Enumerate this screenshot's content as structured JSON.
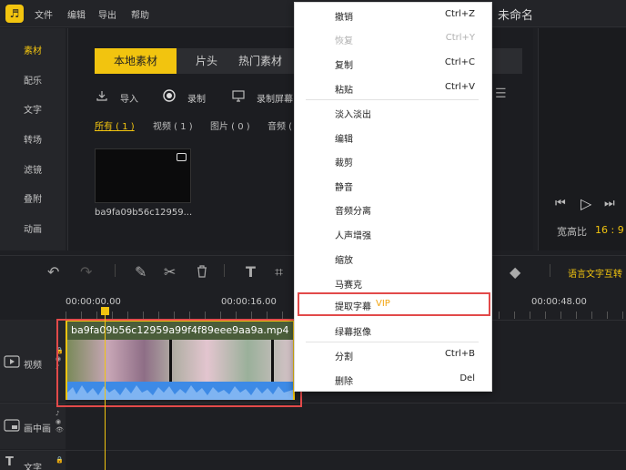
{
  "titlebar": {
    "logo_glyph": "♬",
    "menus": [
      "文件",
      "编辑",
      "导出",
      "帮助"
    ],
    "doc_title": "未命名"
  },
  "leftnav": {
    "items": [
      "素材",
      "配乐",
      "文字",
      "转场",
      "滤镜",
      "叠附",
      "动画"
    ],
    "active_index": 0
  },
  "media": {
    "tabs": [
      "本地素材",
      "片头",
      "热门素材"
    ],
    "active_tab": 0,
    "tools": {
      "import": "导入",
      "record": "录制",
      "record_screen": "录制屏幕"
    },
    "filters": [
      "所有 ( 1 )",
      "视频 ( 1 )",
      "图片 ( 0 )",
      "音频 ("
    ],
    "items": [
      {
        "name": "ba9fa09b56c12959..."
      }
    ]
  },
  "preview": {
    "ratio_label": "宽高比",
    "ratio_value": "16 : 9"
  },
  "toolbar": {
    "speech_to_text": "语言文字互转"
  },
  "ruler": {
    "labels": [
      "00:00:00.00",
      "00:00:16.00",
      "00:00:48.00"
    ]
  },
  "tracks": {
    "video": "视频",
    "pip": "画中画",
    "text": "文字"
  },
  "clip": {
    "name": "ba9fa09b56c12959a99f4f89eee9aa9a.mp4"
  },
  "context_menu": {
    "items": [
      {
        "label": "撤销",
        "shortcut": "Ctrl+Z",
        "disabled": false
      },
      {
        "label": "恢复",
        "shortcut": "Ctrl+Y",
        "disabled": true
      },
      {
        "label": "复制",
        "shortcut": "Ctrl+C",
        "disabled": false
      },
      {
        "label": "粘贴",
        "shortcut": "Ctrl+V",
        "disabled": false
      },
      {
        "label": "淡入淡出",
        "shortcut": "",
        "disabled": false
      },
      {
        "label": "编辑",
        "shortcut": "",
        "disabled": false
      },
      {
        "label": "裁剪",
        "shortcut": "",
        "disabled": false
      },
      {
        "label": "静音",
        "shortcut": "",
        "disabled": false
      },
      {
        "label": "音频分离",
        "shortcut": "",
        "disabled": false
      },
      {
        "label": "人声增强",
        "shortcut": "",
        "disabled": false
      },
      {
        "label": "缩放",
        "shortcut": "",
        "disabled": false
      },
      {
        "label": "马赛克",
        "shortcut": "",
        "disabled": false
      },
      {
        "label": "提取字幕",
        "shortcut": "",
        "disabled": false,
        "badge": "VIP"
      },
      {
        "label": "绿幕抠像",
        "shortcut": "",
        "disabled": false
      },
      {
        "label": "分割",
        "shortcut": "Ctrl+B",
        "disabled": false
      },
      {
        "label": "删除",
        "shortcut": "Del",
        "disabled": false
      }
    ]
  },
  "colors": {
    "accent": "#f2c40f",
    "highlight": "#e24a4a",
    "waveform": "#3d8ae6"
  }
}
